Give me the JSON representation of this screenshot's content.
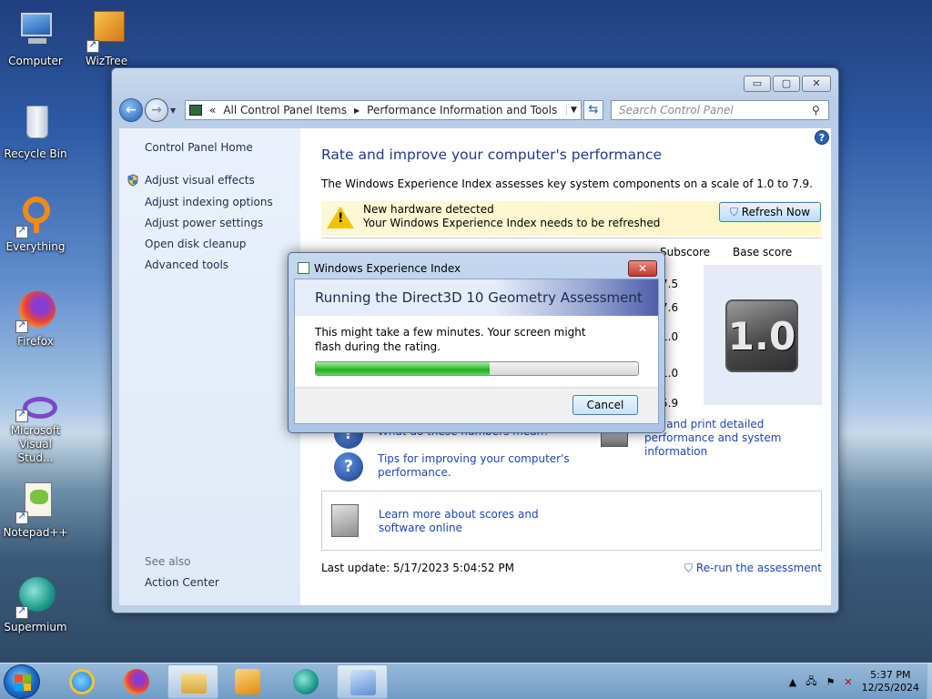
{
  "desktop": {
    "icons": [
      {
        "label": "Computer"
      },
      {
        "label": "WizTree"
      },
      {
        "label": "Recycle Bin"
      },
      {
        "label": "Everything"
      },
      {
        "label": "Firefox"
      },
      {
        "label": "Microsoft Visual Stud..."
      },
      {
        "label": "Notepad++"
      },
      {
        "label": "Supermium"
      }
    ]
  },
  "window": {
    "controls": {
      "minimize": "▭",
      "maximize": "▢",
      "close": "✕"
    },
    "address": {
      "segments": [
        "«",
        "All Control Panel Items",
        "Performance Information and Tools"
      ]
    },
    "search": {
      "placeholder": "Search Control Panel"
    },
    "sidebar": {
      "home": "Control Panel Home",
      "links": [
        "Adjust visual effects",
        "Adjust indexing options",
        "Adjust power settings",
        "Open disk cleanup",
        "Advanced tools"
      ],
      "see_also_label": "See also",
      "see_also_link": "Action Center"
    },
    "main": {
      "heading": "Rate and improve your computer's performance",
      "description": "The Windows Experience Index assesses key system components on a scale of 1.0 to 7.9.",
      "notice": {
        "line1": "New hardware detected",
        "line2": "Your Windows Experience Index needs to be refreshed",
        "button": "Refresh Now"
      },
      "table": {
        "subscore_header": "Subscore",
        "base_header": "Base score",
        "subscores": [
          "7.5",
          "7.6",
          "1.0",
          "1.0",
          "5.9"
        ],
        "base_score": "1.0"
      },
      "links": {
        "numbers_meaning": "What do these numbers mean?",
        "tips": "Tips for improving your computer's performance.",
        "print": "View and print detailed performance and system information",
        "learn_more": "Learn more about scores and software online"
      },
      "last_update": "Last update: 5/17/2023 5:04:52 PM",
      "rerun": "Re-run the assessment"
    }
  },
  "dialog": {
    "title": "Windows Experience Index",
    "banner": "Running the Direct3D 10 Geometry Assessment",
    "message": "This might take a few minutes. Your screen might flash during the rating.",
    "progress": 0.54,
    "cancel": "Cancel"
  },
  "taskbar": {
    "time": "5:37 PM",
    "date": "12/25/2024"
  }
}
